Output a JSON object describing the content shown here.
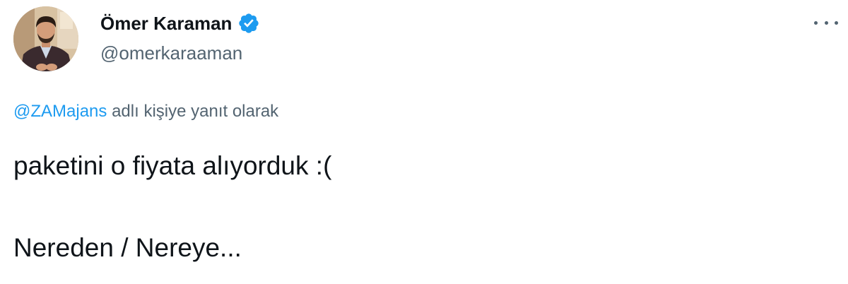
{
  "author": {
    "display_name": "Ömer Karaman",
    "handle": "@omerkaraaman",
    "verified": true,
    "verified_color": "#1d9bf0",
    "avatar_icon": "profile-photo"
  },
  "menu": {
    "icon": "more-horizontal-icon"
  },
  "reply": {
    "mention": "@ZAMajans",
    "suffix": " adlı kişiye yanıt olarak"
  },
  "tweet": {
    "line1": "paketini o fiyata alıyorduk :(",
    "line2": "Nereden / Nereye..."
  },
  "colors": {
    "text": "#0f1419",
    "secondary": "#536471",
    "link": "#1d9bf0"
  }
}
